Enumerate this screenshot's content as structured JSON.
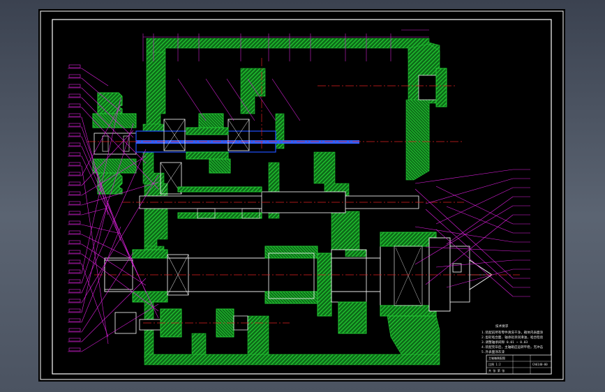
{
  "viewer": {
    "background_color": "#4a5260",
    "canvas_color": "#000000"
  },
  "drawing": {
    "colors": {
      "frame": "#ffffff",
      "hatch": "#22c832",
      "hatch_bg": "#0b3a10",
      "leader": "#e020e0",
      "centerline": "#e02020",
      "dimension": "#d020d0",
      "outline": "#ffffff",
      "shaft_metal": "#ffffff",
      "bearing": "#ffffff"
    },
    "icons": {
      "tailstock_center": "cone-point-icon"
    },
    "technical_requirements": {
      "title": "技术要求",
      "lines": [
        "1.装配前所有零件清洗干净，箱体内表面涂",
        "2.齿轮啮合面、轴承处涂润滑油，啮合检验",
        "3.调整轴承间隙 0.01 ~ 0.03",
        "4.装配完毕后，主轴箱应运转平稳，无冲击",
        "5.外表面涂灰漆"
      ]
    },
    "title_block": {
      "drawing_number": "CA6140-00",
      "rows": [
        "主轴箱装配图",
        "比例 1:2",
        "共 张 第 张"
      ]
    }
  }
}
